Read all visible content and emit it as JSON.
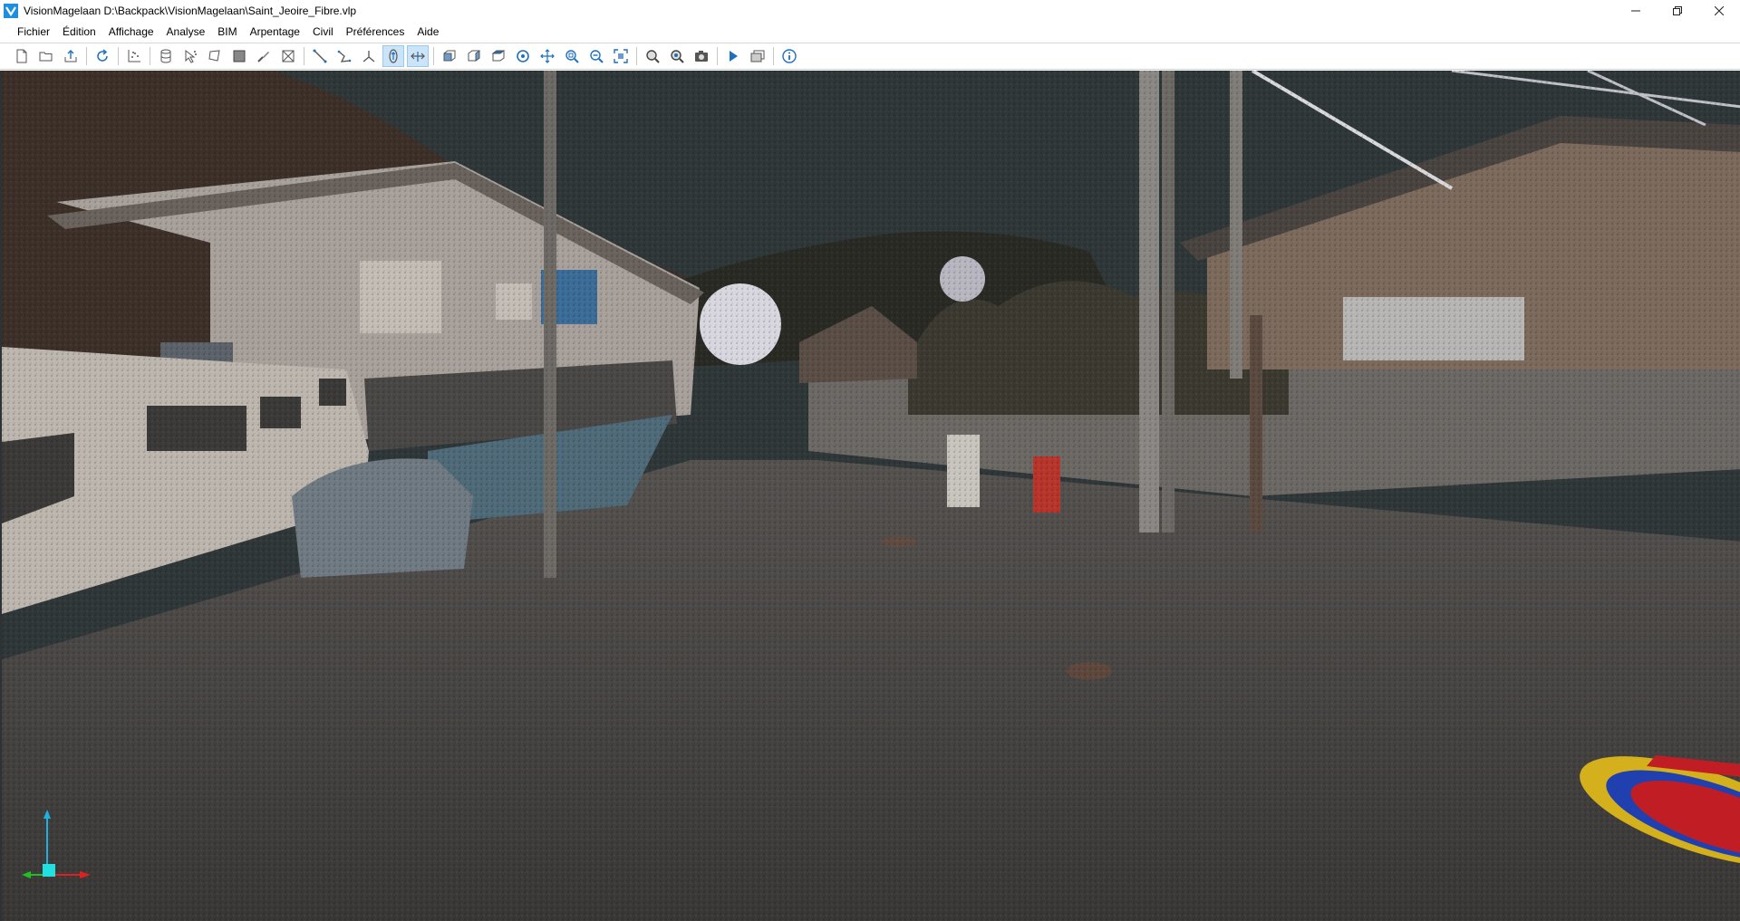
{
  "window": {
    "title": "VisionMagelaan D:\\Backpack\\VisionMagelaan\\Saint_Jeoire_Fibre.vlp",
    "app_icon": "visionmagelaan-logo-icon",
    "controls": [
      "minimize-icon",
      "restore-icon",
      "close-icon"
    ]
  },
  "menu": {
    "items": [
      "Fichier",
      "Édition",
      "Affichage",
      "Analyse",
      "BIM",
      "Arpentage",
      "Civil",
      "Préférences",
      "Aide"
    ]
  },
  "toolbar": {
    "groups": [
      [
        "new-file-icon",
        "open-folder-icon",
        "export-icon"
      ],
      [
        "refresh-icon"
      ],
      [
        "scatter-plot-icon"
      ],
      [
        "database-icon",
        "select-points-icon",
        "polygon-icon",
        "clip-box-icon",
        "edit-points-icon",
        "segment-icon"
      ],
      [
        "measure-distance-icon",
        "measure-polyline-icon",
        "coordinate-axes-icon",
        "orbit-mode-icon",
        "pan-mode-icon"
      ],
      [
        "view-front-icon",
        "view-side-icon",
        "view-top-icon",
        "rotate-view-icon",
        "move-view-icon",
        "zoom-window-icon",
        "zoom-out-icon",
        "zoom-extents-icon"
      ],
      [
        "search-icon",
        "target-search-icon",
        "camera-icon"
      ],
      [
        "play-icon",
        "windows-icon"
      ],
      [
        "info-icon"
      ]
    ],
    "active": [
      "orbit-mode-icon",
      "pan-mode-icon"
    ]
  },
  "viewport": {
    "content": "point-cloud-3d-view",
    "background_color": "#2f3739",
    "axis_colors": {
      "x": "#e02020",
      "y": "#20c020",
      "z": "#20b0e0"
    }
  }
}
